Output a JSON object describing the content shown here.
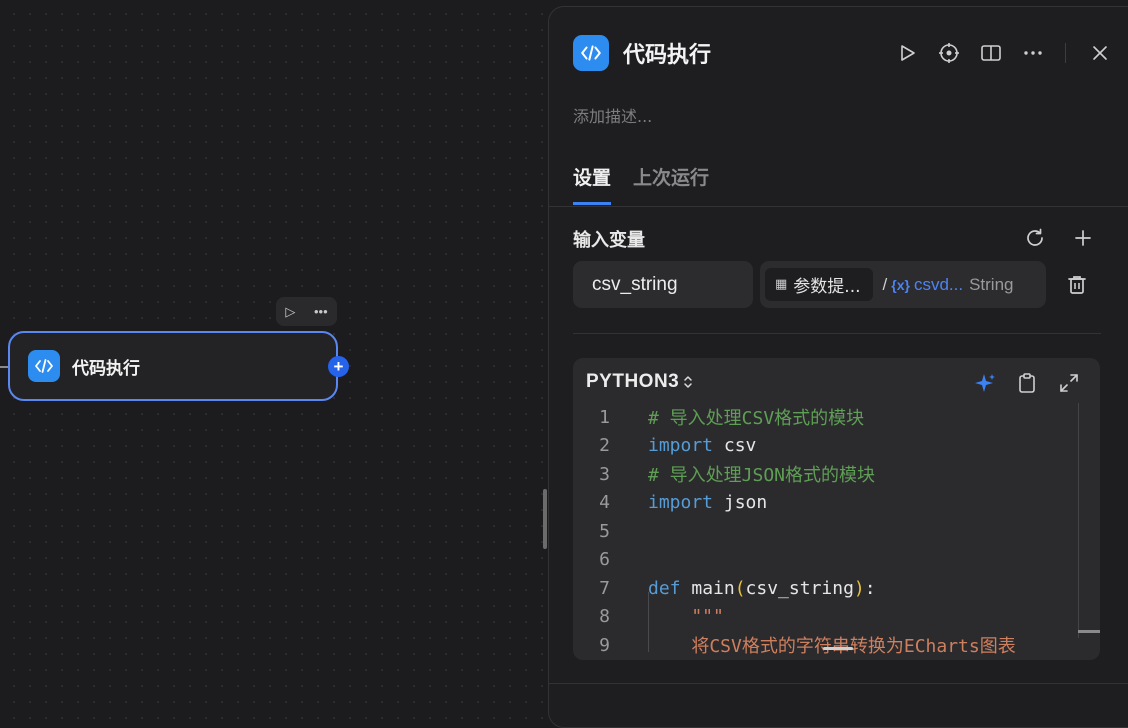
{
  "node": {
    "title": "代码执行",
    "toolbar": {
      "run_icon": "▷",
      "more_icon": "•••"
    },
    "add_icon": "+"
  },
  "panel": {
    "title": "代码执行",
    "description_placeholder": "添加描述...",
    "tabs": [
      {
        "label": "设置",
        "active": true
      },
      {
        "label": "上次运行",
        "active": false
      }
    ],
    "input_vars": {
      "title": "输入变量",
      "rows": [
        {
          "name": "csv_string",
          "source_node": "参数提...",
          "separator": "/",
          "var_icon": "{x}",
          "var_name": "csvd...",
          "type": "String"
        }
      ]
    },
    "code": {
      "language": "PYTHON3",
      "lines": [
        {
          "num": "1",
          "tokens": [
            {
              "c": "cm",
              "t": "# 导入处理CSV格式的模块"
            }
          ]
        },
        {
          "num": "2",
          "tokens": [
            {
              "c": "kw",
              "t": "import"
            },
            {
              "c": "tx",
              "t": " csv"
            }
          ]
        },
        {
          "num": "3",
          "tokens": [
            {
              "c": "cm",
              "t": "# 导入处理JSON格式的模块"
            }
          ]
        },
        {
          "num": "4",
          "tokens": [
            {
              "c": "kw",
              "t": "import"
            },
            {
              "c": "tx",
              "t": " json"
            }
          ]
        },
        {
          "num": "5",
          "tokens": []
        },
        {
          "num": "6",
          "tokens": []
        },
        {
          "num": "7",
          "tokens": [
            {
              "c": "kw",
              "t": "def"
            },
            {
              "c": "tx",
              "t": " main"
            },
            {
              "c": "br",
              "t": "("
            },
            {
              "c": "tx",
              "t": "csv_string"
            },
            {
              "c": "br",
              "t": ")"
            },
            {
              "c": "tx",
              "t": ":"
            }
          ]
        },
        {
          "num": "8",
          "tokens": [
            {
              "c": "st",
              "t": "    \"\"\""
            }
          ]
        },
        {
          "num": "9",
          "tokens": [
            {
              "c": "st",
              "t": "    将CSV格式的字符串转换为ECharts图表"
            }
          ]
        }
      ]
    }
  },
  "colors": {
    "accent": "#2d8cf0",
    "selection_border": "#5b87f0",
    "comment": "#5f9e55",
    "keyword": "#569cd6",
    "string": "#ce7f5d"
  },
  "icons": [
    "code-icon",
    "play-icon",
    "locate-icon",
    "book-icon",
    "more-icon",
    "close-icon",
    "refresh-icon",
    "plus-icon",
    "trash-icon",
    "sparkle-icon",
    "clipboard-icon",
    "expand-icon"
  ]
}
